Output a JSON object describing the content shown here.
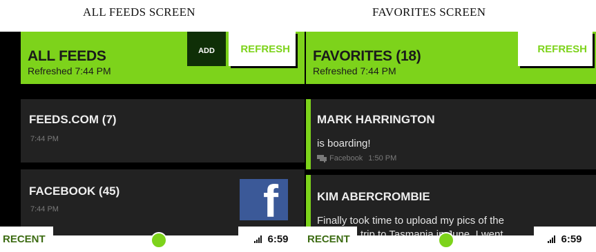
{
  "captions": {
    "left": "ALL FEEDS SCREEN",
    "right": "FAVORITES SCREEN"
  },
  "all_feeds": {
    "title": "ALL FEEDS",
    "subtitle": "Refreshed 7:44 PM",
    "add_label": "ADD",
    "refresh_label": "REFRESH",
    "feeds": [
      {
        "title": "FEEDS.COM (7)",
        "time": "7:44 PM"
      },
      {
        "title": "FACEBOOK (45)",
        "time": "7:44 PM",
        "logo_icon": "facebook-logo"
      }
    ]
  },
  "favorites": {
    "title": "FAVORITES (18)",
    "subtitle": "Refreshed 7:44 PM",
    "refresh_label": "REFRESH",
    "items": [
      {
        "name": "MARK HARRINGTON",
        "message": "is boarding!",
        "source": "Facebook",
        "time": "1:50 PM",
        "icon": "comment-icon"
      },
      {
        "name": "KIM ABERCROMBIE",
        "message": "Finally took time to upload my pics of the",
        "message2": "trip to Tasmania in June. I went"
      }
    ]
  },
  "bottom_bar": {
    "recent_label": "RECENT",
    "clock": "6:59",
    "signal_icon": "signal-bars-icon"
  },
  "colors": {
    "accent": "#7dd31b",
    "tile": "#222222",
    "add_button": "#0f2f07",
    "facebook": "#3b5998"
  }
}
